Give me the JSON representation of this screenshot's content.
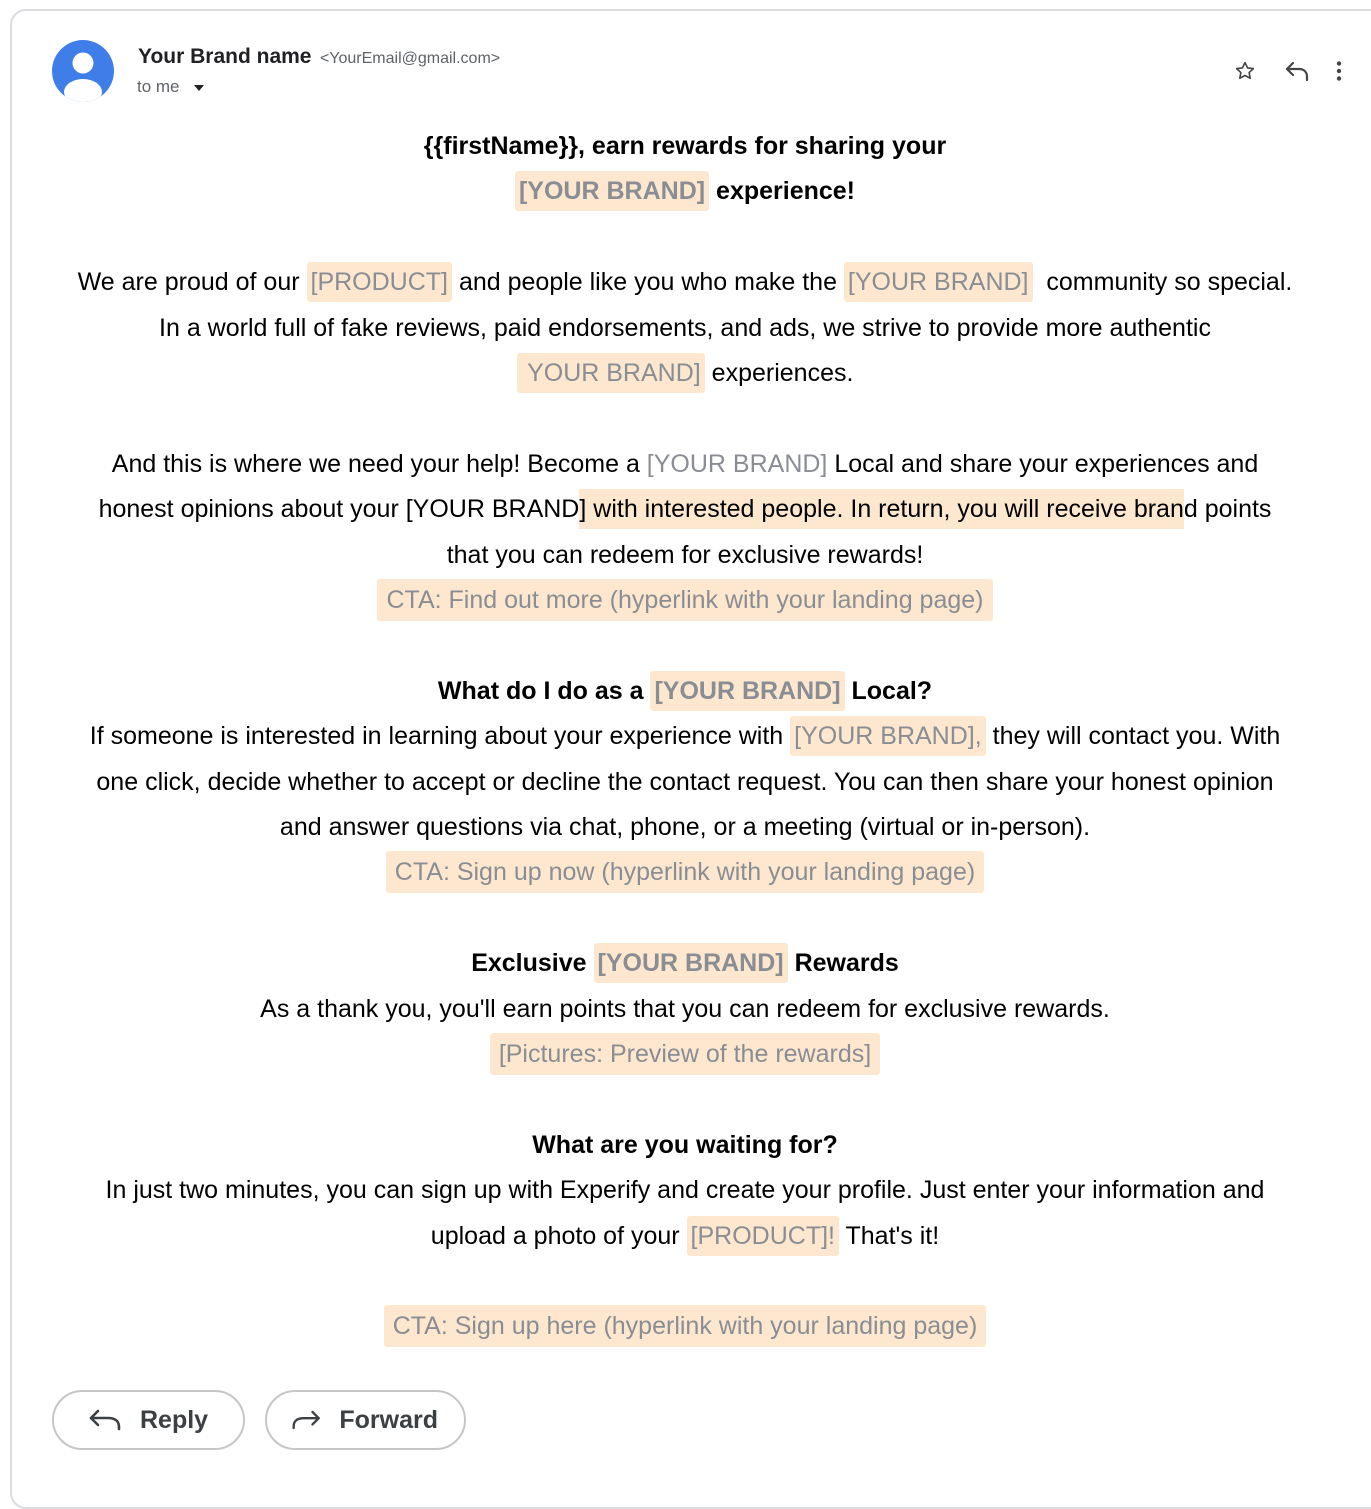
{
  "header": {
    "sender_name": "Your Brand name",
    "sender_email": "<YourEmail@gmail.com>",
    "recipient_label": "to me",
    "icons": [
      "star-icon",
      "reply-icon",
      "more-vert-icon",
      "chevron-down-icon",
      "avatar-icon"
    ]
  },
  "email": {
    "title": {
      "line1": "{{firstName}}, earn rewards for sharing your",
      "brand": "[YOUR BRAND]",
      "line2_suffix": " experience!"
    },
    "intro": {
      "t1": "We are proud of our ",
      "product": "[PRODUCT]",
      "t2": " and people like you who make the ",
      "brand": "[YOUR BRAND]",
      "t3": "  community so special.",
      "t4": "In a world full of fake reviews, paid endorsements, and ads, we strive to provide more authentic",
      "brand2": " YOUR BRAND]",
      "t5": " experiences."
    },
    "help": {
      "t1": "And this is where we need your help! Become a ",
      "brand": "[YOUR BRAND]",
      "t2": " Local and share your experiences and",
      "t3": "honest opinions about your [YOUR BRAND",
      "hl": "] with interested people. In return, you will receive bran",
      "t4": "d points",
      "t5": "that you can redeem for exclusive rewards!",
      "cta": "CTA: Find out more (hyperlink with your landing page)"
    },
    "local": {
      "heading_prefix": "What do I do as a ",
      "brand": "[YOUR BRAND]",
      "heading_suffix": " Local?",
      "t1": "If someone is interested in learning about your experience with ",
      "brand2": "[YOUR BRAND],",
      "t2": " they will contact you. With",
      "t3": "one click, decide whether to accept or decline the contact request. You can then share your honest opinion",
      "t4": "and answer questions via chat, phone, or a meeting (virtual or in-person).",
      "cta": "CTA: Sign up now (hyperlink with your landing page)"
    },
    "rewards": {
      "heading_prefix": "Exclusive ",
      "brand": "[YOUR BRAND]",
      "heading_suffix": " Rewards",
      "t1": "As a thank you, you'll earn points that you can redeem for exclusive rewards.",
      "pictures": "[Pictures: Preview of the rewards]"
    },
    "waiting": {
      "heading": "What are you waiting for?",
      "t1": "In just two minutes, you can sign up with Experify and create your profile. Just enter your information and",
      "t2": "upload a photo of your ",
      "product": "[PRODUCT]!",
      "t3": " That's it!",
      "cta": "CTA: Sign up here (hyperlink with your landing page)"
    }
  },
  "footer": {
    "reply_label": "Reply",
    "forward_label": "Forward"
  },
  "colors": {
    "placeholder_bg": "#fde8cf",
    "placeholder_text": "#8a8d93",
    "avatar": "#3f7ee8",
    "border": "#dadce0"
  }
}
